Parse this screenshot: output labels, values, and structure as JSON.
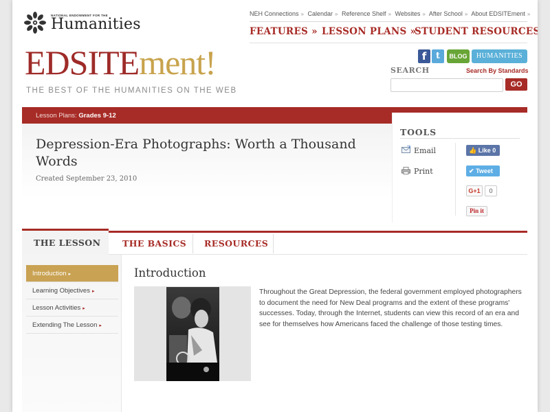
{
  "header": {
    "neh_small": "NATIONAL ENDOWMENT FOR THE",
    "neh_name": "Humanities",
    "utility_links": [
      "NEH Connections",
      "Calendar",
      "Reference Shelf",
      "Websites",
      "After School",
      "About EDSITEment"
    ],
    "utility_sep": "»",
    "main_nav": [
      "FEATURES »",
      "LESSON PLANS »",
      "STUDENT RESOURCES »"
    ],
    "site_logo_part1": "EDSITE",
    "site_logo_part2": "ment!",
    "tagline": "THE BEST OF THE HUMANITIES ON THE WEB",
    "social": {
      "facebook": "f",
      "twitter": "t",
      "blog": "BLOG",
      "humanities": "HUMANITIES"
    },
    "search": {
      "label": "SEARCH",
      "by_standards": "Search By Standards",
      "placeholder": "",
      "go": "GO"
    }
  },
  "breadcrumb": {
    "section": "Lesson Plans:",
    "grade": "Grades 9-12"
  },
  "lesson": {
    "title": "Depression-Era Photographs: Worth a Thousand Words",
    "created": "Created September 23, 2010"
  },
  "tools": {
    "title": "TOOLS",
    "email": "Email",
    "print": "Print",
    "like": "Like",
    "like_count": "0",
    "tweet": "Tweet",
    "gplus": "G+1",
    "gplus_count": "0",
    "pin": "Pin it"
  },
  "tabs": [
    "THE LESSON",
    "THE BASICS",
    "RESOURCES"
  ],
  "active_tab": "THE LESSON",
  "sidebar": {
    "items": [
      "Introduction",
      "Learning Objectives",
      "Lesson Activities",
      "Extending The Lesson"
    ],
    "active": "Introduction",
    "arrow": "▸"
  },
  "content": {
    "heading": "Introduction",
    "text": "Throughout the Great Depression, the federal government employed photographers to document the need for New Deal programs and the extent of these programs' successes. Today, through the Internet, students can view this record of an era and see for themselves how Americans faced the challenge of those testing times."
  },
  "colors": {
    "brand_red": "#a72b26",
    "brand_gold": "#c8a34d",
    "sidebar_active": "#c9a253"
  }
}
